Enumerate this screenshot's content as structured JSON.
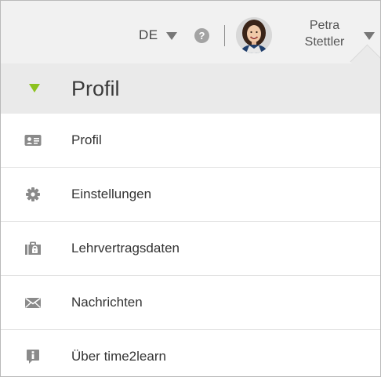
{
  "topbar": {
    "language": "DE",
    "help_symbol": "?",
    "user": {
      "first_name": "Petra",
      "last_name": "Stettler"
    }
  },
  "section": {
    "title": "Profil",
    "accent_color": "#8cc21f"
  },
  "menu": {
    "items": [
      {
        "label": "Profil",
        "icon": "id-card-icon"
      },
      {
        "label": "Einstellungen",
        "icon": "gear-icon"
      },
      {
        "label": "Lehrvertragsdaten",
        "icon": "briefcase-lock-icon"
      },
      {
        "label": "Nachrichten",
        "icon": "envelope-icon"
      },
      {
        "label": "Über time2learn",
        "icon": "info-bubble-icon"
      }
    ]
  }
}
